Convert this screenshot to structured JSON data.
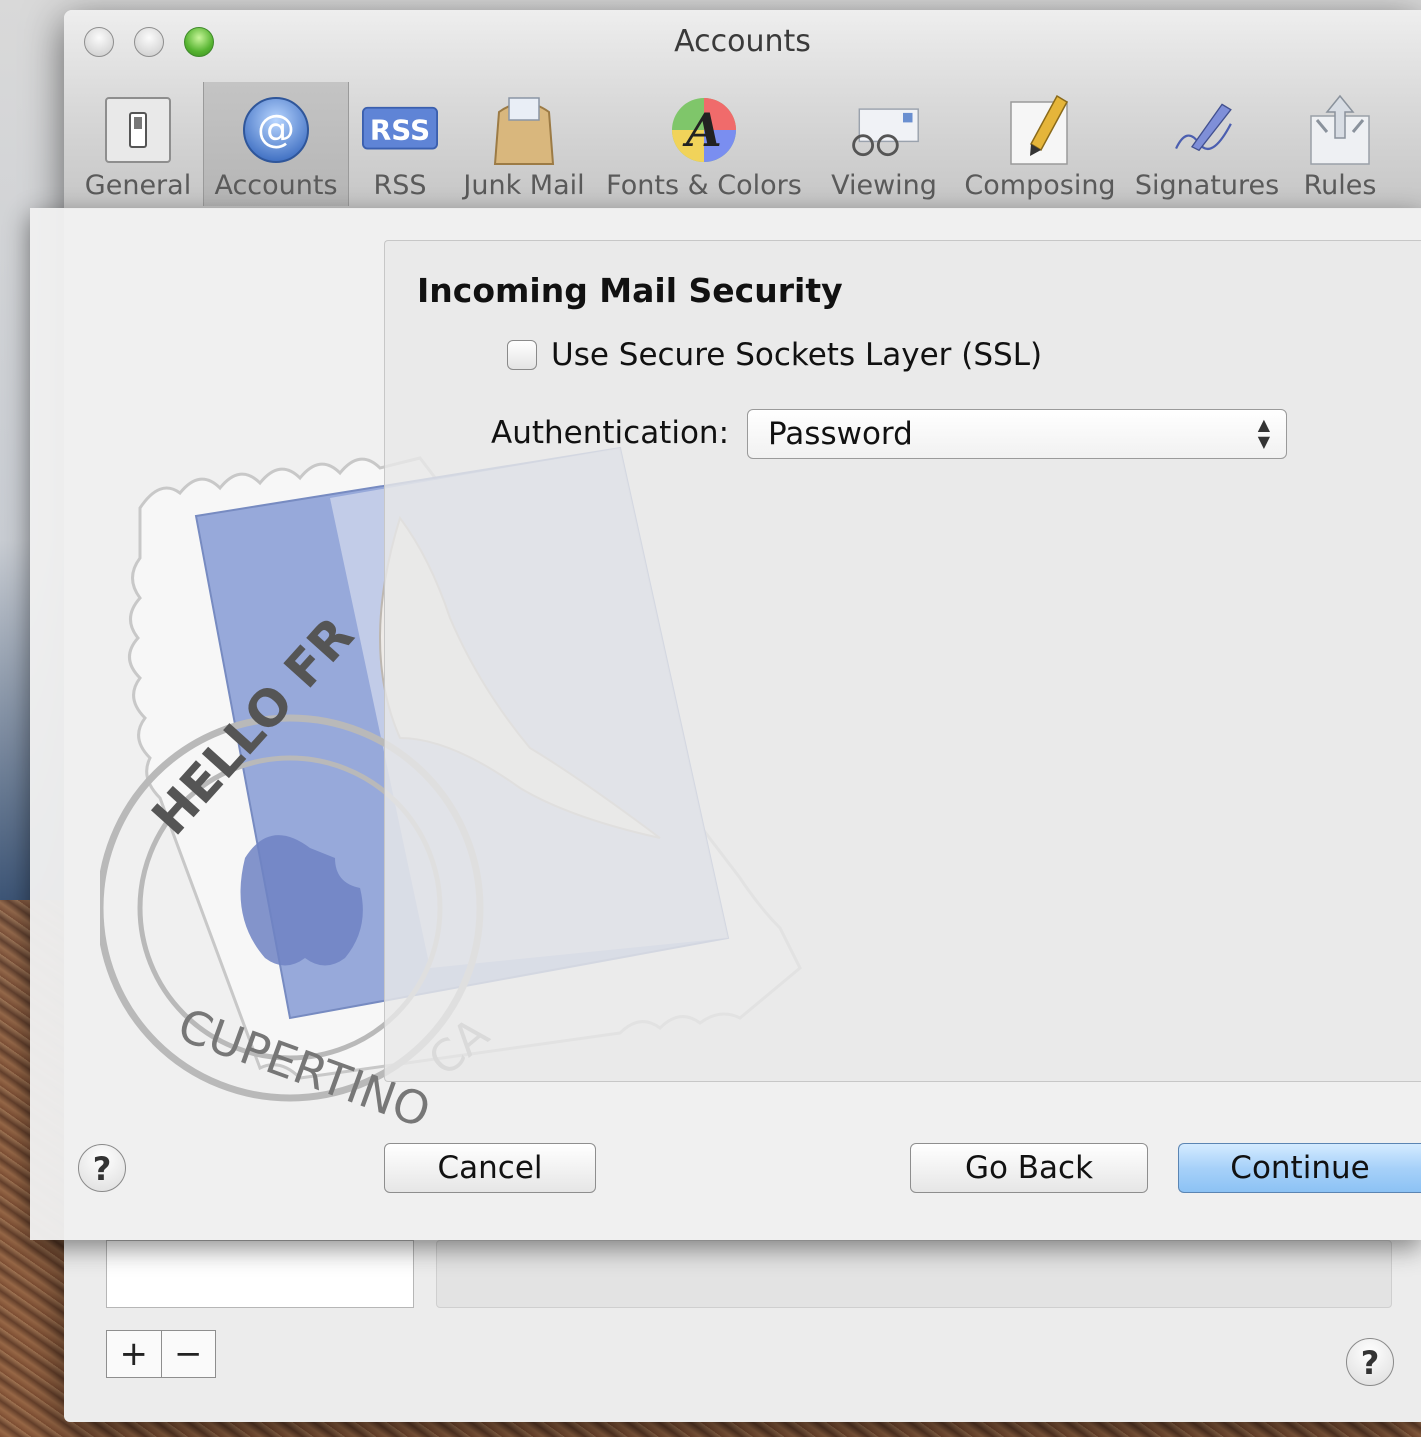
{
  "window": {
    "title": "Accounts"
  },
  "toolbar": {
    "items": [
      {
        "label": "General",
        "icon": "general-switch-icon"
      },
      {
        "label": "Accounts",
        "icon": "at-sign-icon"
      },
      {
        "label": "RSS",
        "icon": "rss-icon"
      },
      {
        "label": "Junk Mail",
        "icon": "junk-mail-bag-icon"
      },
      {
        "label": "Fonts & Colors",
        "icon": "font-colors-icon"
      },
      {
        "label": "Viewing",
        "icon": "glasses-icon"
      },
      {
        "label": "Composing",
        "icon": "pencil-paper-icon"
      },
      {
        "label": "Signatures",
        "icon": "pen-signature-icon"
      },
      {
        "label": "Rules",
        "icon": "rules-arrows-icon"
      }
    ],
    "rss_badge": "RSS",
    "at_symbol": "@",
    "font_letter": "A",
    "selected": "Accounts"
  },
  "sheet": {
    "section_title": "Incoming Mail Security",
    "ssl": {
      "label": "Use Secure Sockets Layer (SSL)",
      "checked": false
    },
    "authentication": {
      "label": "Authentication:",
      "value": "Password"
    },
    "buttons": {
      "cancel": "Cancel",
      "go_back": "Go Back",
      "continue": "Continue"
    },
    "help": "?"
  },
  "background": {
    "add": "+",
    "remove": "−",
    "help": "?"
  },
  "stamp": {
    "top_text": "HELLO FR",
    "bottom_text": "CUPERTINO",
    "suffix": "CA"
  }
}
